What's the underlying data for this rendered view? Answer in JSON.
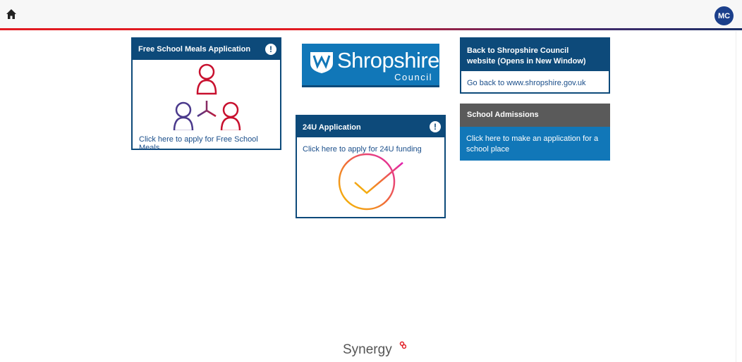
{
  "header": {
    "avatar_initials": "MC"
  },
  "tiles": {
    "fsm": {
      "title": "Free School Meals Application",
      "link": "Click here to apply for Free School Meals"
    },
    "logo": {
      "name": "Shropshire",
      "sub": "Council"
    },
    "u24": {
      "title": "24U Application",
      "link": "Click here to apply for 24U funding"
    },
    "back": {
      "title_line1": "Back to Shropshire Council",
      "title_line2": "website (Opens in New Window)",
      "link": "Go back to www.shropshire.gov.uk"
    },
    "admissions": {
      "title": "School Admissions",
      "link_line1": "Click here to make an application for a",
      "link_line2": "school place"
    }
  },
  "footer": {
    "brand": "Synergy"
  },
  "colors": {
    "accent": "#0d4a7a",
    "red": "#e11b22",
    "admissions_blue": "#1177b8",
    "admissions_header": "#5a5a5a"
  }
}
